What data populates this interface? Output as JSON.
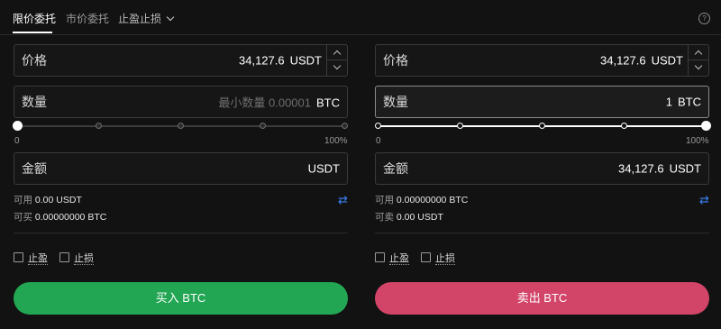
{
  "tabs": [
    {
      "label": "限价委托",
      "active": true
    },
    {
      "label": "市价委托",
      "active": false
    },
    {
      "label": "止盈止损",
      "active": false,
      "has_dropdown": true
    }
  ],
  "help_icon": "?",
  "buy": {
    "price_label": "价格",
    "price_value": "34,127.6",
    "price_unit": "USDT",
    "qty_label": "数量",
    "qty_placeholder": "最小数量 0.00001",
    "qty_unit": "BTC",
    "slider_min": "0",
    "slider_max": "100%",
    "slider_value": 0,
    "amount_label": "金额",
    "amount_value": "",
    "amount_unit": "USDT",
    "avail_label": "可用",
    "avail_value": "0.00 USDT",
    "max_label": "可买",
    "max_value": "0.00000000 BTC",
    "tp_label": "止盈",
    "sl_label": "止损",
    "button_label": "买入 BTC",
    "button_color": "#22a653"
  },
  "sell": {
    "price_label": "价格",
    "price_value": "34,127.6",
    "price_unit": "USDT",
    "qty_label": "数量",
    "qty_value": "1",
    "qty_unit": "BTC",
    "slider_min": "0",
    "slider_max": "100%",
    "slider_value": 1,
    "amount_label": "金额",
    "amount_value": "34,127.6",
    "amount_unit": "USDT",
    "avail_label": "可用",
    "avail_value": "0.00000000 BTC",
    "max_label": "可卖",
    "max_value": "0.00 USDT",
    "tp_label": "止盈",
    "sl_label": "止损",
    "button_label": "卖出 BTC",
    "button_color": "#d24468"
  },
  "swap_icon": "⇄"
}
